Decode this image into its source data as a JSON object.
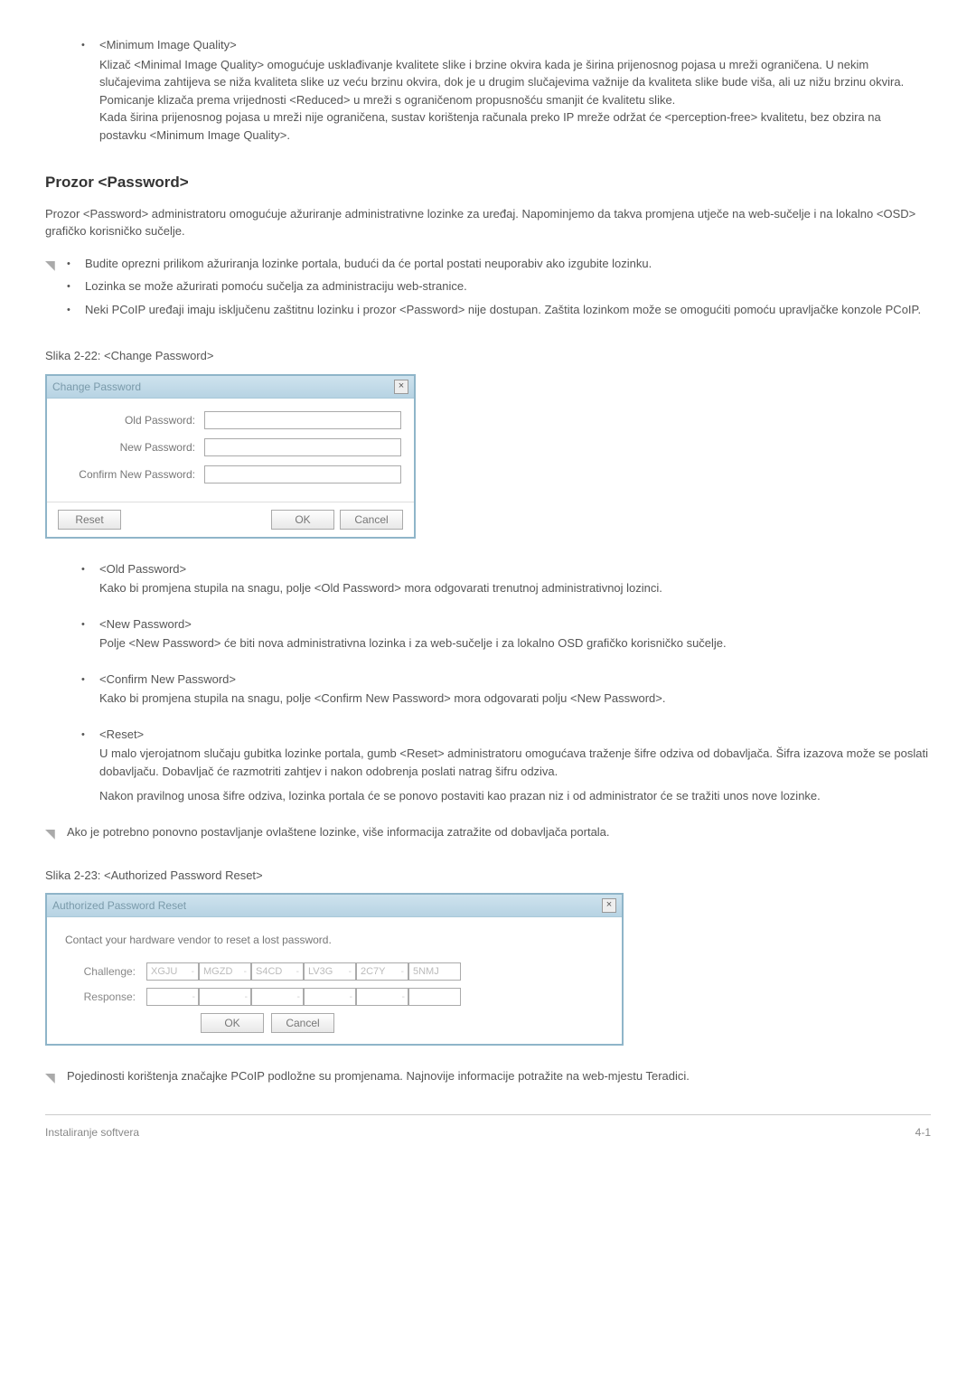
{
  "section1": {
    "term": "<Minimum Image Quality>",
    "p1": "Klizač <Minimal Image Quality> omogućuje usklađivanje kvalitete slike i brzine okvira kada je širina prijenosnog pojasa u mreži ograničena. U nekim slučajevima zahtijeva se niža kvaliteta slike uz veću brzinu okvira, dok je u drugim slučajevima važnije da kvaliteta slike bude viša, ali uz nižu brzinu okvira.",
    "p2": "Pomicanje klizača prema vrijednosti <Reduced> u mreži s ograničenom propusnošću smanjit će kvalitetu slike.",
    "p3": "Kada širina prijenosnog pojasa u mreži nije ograničena, sustav korištenja računala preko IP mreže održat će <perception-free> kvalitetu, bez obzira na postavku <Minimum Image Quality>."
  },
  "heading": "Prozor <Password>",
  "intro": "Prozor <Password> administratoru omogućuje ažuriranje administrativne lozinke za uređaj. Napominjemo da takva promjena utječe na web-sučelje i na lokalno <OSD> grafičko korisničko sučelje.",
  "notes1": [
    "Budite oprezni prilikom ažuriranja lozinke portala, budući da će portal postati neuporabiv ako izgubite lozinku.",
    "Lozinka se može ažurirati pomoću sučelja za administraciju web-stranice.",
    "Neki PCoIP uređaji imaju isključenu zaštitnu lozinku i prozor <Password> nije dostupan. Zaštita lozinkom može se omogućiti pomoću upravljačke konzole PCoIP."
  ],
  "fig1_caption": "Slika 2-22: <Change Password>",
  "dialog1": {
    "title": "Change Password",
    "old": "Old Password:",
    "new": "New Password:",
    "confirm": "Confirm New Password:",
    "reset": "Reset",
    "ok": "OK",
    "cancel": "Cancel"
  },
  "fields": [
    {
      "term": "<Old Password>",
      "desc": "Kako bi promjena stupila na snagu, polje <Old Password> mora odgovarati trenutnoj administrativnoj lozinci."
    },
    {
      "term": "<New Password>",
      "desc": "Polje <New Password> će biti nova administrativna lozinka i za web-sučelje i za lokalno OSD grafičko korisničko sučelje."
    },
    {
      "term": "<Confirm New Password>",
      "desc": "Kako bi promjena stupila na snagu, polje <Confirm New Password> mora odgovarati polju <New Password>."
    },
    {
      "term": "<Reset>",
      "desc": "U malo vjerojatnom slučaju gubitka lozinke portala, gumb <Reset> administratoru omogućava traženje šifre odziva od dobavljača. Šifra izazova može se poslati dobavljaču. Dobavljač će razmotriti zahtjev i nakon odobrenja poslati natrag šifru odziva.",
      "desc2": "Nakon pravilnog unosa šifre odziva, lozinka portala će se ponovo postaviti kao prazan niz i od administrator će se tražiti unos nove lozinke."
    }
  ],
  "note2": "Ako je potrebno ponovno postavljanje ovlaštene lozinke, više informacija zatražite od dobavljača portala.",
  "fig2_caption": "Slika 2-23: <Authorized Password Reset>",
  "dialog2": {
    "title": "Authorized Password Reset",
    "contact": "Contact your hardware vendor to reset a lost password.",
    "challenge_label": "Challenge:",
    "response_label": "Response:",
    "challenge": [
      "XGJU",
      "MGZD",
      "S4CD",
      "LV3G",
      "2C7Y",
      "5NMJ"
    ],
    "ok": "OK",
    "cancel": "Cancel"
  },
  "note3": "Pojedinosti korištenja značajke PCoIP podložne su promjenama. Najnovije informacije potražite na web-mjestu Teradici.",
  "footer_left": "Instaliranje softvera",
  "footer_right": "4-1"
}
